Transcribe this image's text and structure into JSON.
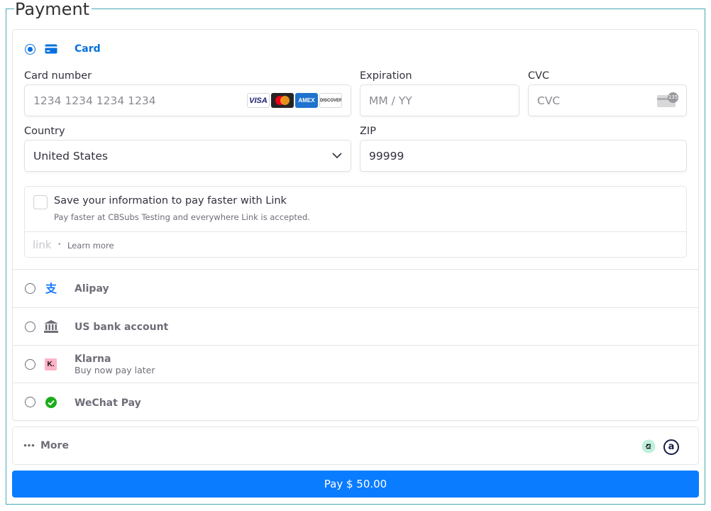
{
  "payment": {
    "legend": "Payment",
    "card": {
      "label": "Card",
      "card_number_label": "Card number",
      "card_number_placeholder": "1234 1234 1234 1234",
      "brands": [
        "VISA",
        "AMEX",
        "DISCOVER"
      ],
      "expiration_label": "Expiration",
      "expiration_placeholder": "MM / YY",
      "cvc_label": "CVC",
      "cvc_placeholder": "CVC",
      "cvc_icon_text": "135",
      "country_label": "Country",
      "country_value": "United States",
      "zip_label": "ZIP",
      "zip_value": "99999"
    },
    "link": {
      "title": "Save your information to pay faster with Link",
      "subtitle": "Pay faster at CBSubs Testing and everywhere Link is accepted.",
      "logo_text": "link",
      "learn_more": "Learn more"
    },
    "methods": [
      {
        "label": "Alipay",
        "icon": "alipay-icon"
      },
      {
        "label": "US bank account",
        "icon": "bank-icon"
      },
      {
        "label": "Klarna",
        "sublabel": "Buy now pay later",
        "icon": "klarna-icon",
        "icon_text": "K."
      },
      {
        "label": "WeChat Pay",
        "icon": "wechat-icon"
      }
    ],
    "more_label": "More",
    "more_icon_text": "a",
    "pay_button": "Pay $ 50.00",
    "colors": {
      "accent": "#0570de",
      "button": "#0a7cff",
      "border": "#4aa8b8"
    }
  }
}
